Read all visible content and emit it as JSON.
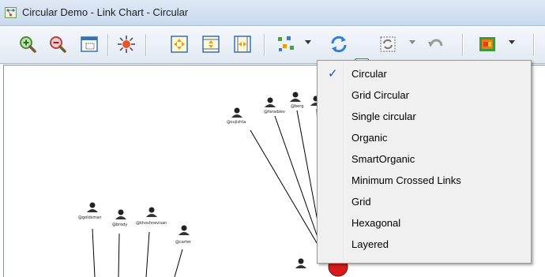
{
  "window": {
    "title": "Circular Demo - Link Chart - Circular"
  },
  "toolbar": {
    "buttons": [
      {
        "name": "zoom-in-icon"
      },
      {
        "name": "zoom-out-icon"
      },
      {
        "name": "fit-window-icon"
      },
      {
        "name": "highlight-icon"
      },
      {
        "name": "expand-all-icon"
      },
      {
        "name": "expand-vertical-icon"
      },
      {
        "name": "expand-horizontal-icon"
      },
      {
        "name": "layout-scatter-icon"
      },
      {
        "name": "layout-refresh-icon"
      },
      {
        "name": "incremental-layout-icon"
      },
      {
        "name": "undo-icon"
      },
      {
        "name": "color-palette-icon"
      }
    ]
  },
  "layout_menu": {
    "items": [
      {
        "label": "Circular",
        "checked": true
      },
      {
        "label": "Grid Circular",
        "checked": false
      },
      {
        "label": "Single circular",
        "checked": false
      },
      {
        "label": "Organic",
        "checked": false
      },
      {
        "label": "SmartOrganic",
        "checked": false
      },
      {
        "label": "Minimum Crossed Links",
        "checked": false
      },
      {
        "label": "Grid",
        "checked": false
      },
      {
        "label": "Hexagonal",
        "checked": false
      },
      {
        "label": "Layered",
        "checked": false
      }
    ],
    "check_glyph": "✓"
  },
  "chart": {
    "node_labels": {
      "n1": "@sujishta",
      "n2": "@faradzev",
      "n3": "@berg",
      "n4": "@goldsman",
      "n5": "@brody",
      "n6": "@khoshnevisan",
      "n7": "@carter"
    }
  }
}
